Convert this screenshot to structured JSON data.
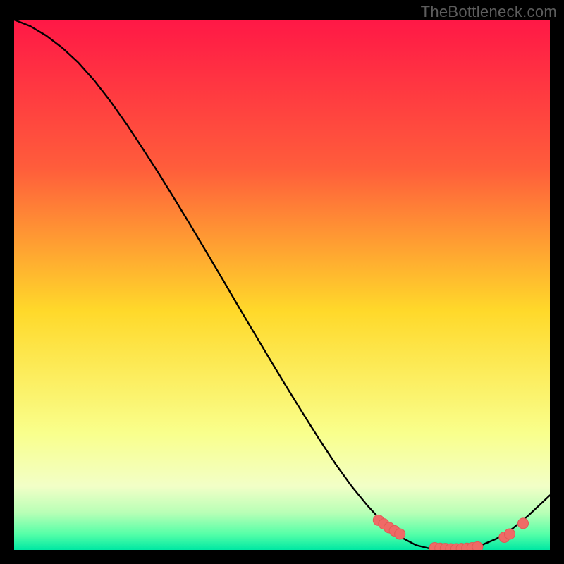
{
  "watermark": "TheBottleneck.com",
  "colors": {
    "frame_bg": "#000000",
    "curve": "#000000",
    "marker_fill": "#ef6a66",
    "marker_stroke": "#e05a56",
    "gradient_top": "#ff1846",
    "gradient_upper": "#ff5d3b",
    "gradient_mid": "#ffd92a",
    "gradient_lower": "#f9ff8c",
    "gradient_pale": "#f2ffc7",
    "gradient_green1": "#b8ffb6",
    "gradient_green2": "#56ffa8",
    "gradient_green3": "#00e8a3"
  },
  "chart_data": {
    "type": "line",
    "title": "",
    "xlabel": "",
    "ylabel": "",
    "xlim": [
      0,
      100
    ],
    "ylim": [
      0,
      100
    ],
    "series": [
      {
        "name": "bottleneck-curve",
        "x": [
          0,
          3,
          6,
          9,
          12,
          15,
          18,
          21,
          24,
          27,
          30,
          33,
          36,
          39,
          42,
          45,
          48,
          51,
          54,
          57,
          60,
          63,
          66,
          69,
          72,
          75,
          78,
          81,
          84,
          87,
          90,
          93,
          96,
          100
        ],
        "y": [
          100,
          98.8,
          97.0,
          94.7,
          91.9,
          88.5,
          84.6,
          80.3,
          75.7,
          71.0,
          66.1,
          61.1,
          56.0,
          50.9,
          45.7,
          40.6,
          35.5,
          30.5,
          25.6,
          20.8,
          16.2,
          12.0,
          8.3,
          5.0,
          2.5,
          0.9,
          0.15,
          0.0,
          0.15,
          0.8,
          2.1,
          4.0,
          6.5,
          10.3
        ]
      }
    ],
    "markers": {
      "name": "highlight-points",
      "points": [
        {
          "x": 68.0,
          "y": 5.6
        },
        {
          "x": 69.0,
          "y": 4.9
        },
        {
          "x": 70.0,
          "y": 4.2
        },
        {
          "x": 71.0,
          "y": 3.6
        },
        {
          "x": 72.0,
          "y": 3.0
        },
        {
          "x": 78.5,
          "y": 0.4
        },
        {
          "x": 79.5,
          "y": 0.3
        },
        {
          "x": 80.5,
          "y": 0.25
        },
        {
          "x": 81.5,
          "y": 0.2
        },
        {
          "x": 82.5,
          "y": 0.2
        },
        {
          "x": 83.5,
          "y": 0.25
        },
        {
          "x": 84.5,
          "y": 0.3
        },
        {
          "x": 85.5,
          "y": 0.4
        },
        {
          "x": 86.5,
          "y": 0.55
        },
        {
          "x": 91.5,
          "y": 2.4
        },
        {
          "x": 92.5,
          "y": 3.0
        },
        {
          "x": 95.0,
          "y": 5.0
        }
      ]
    }
  }
}
